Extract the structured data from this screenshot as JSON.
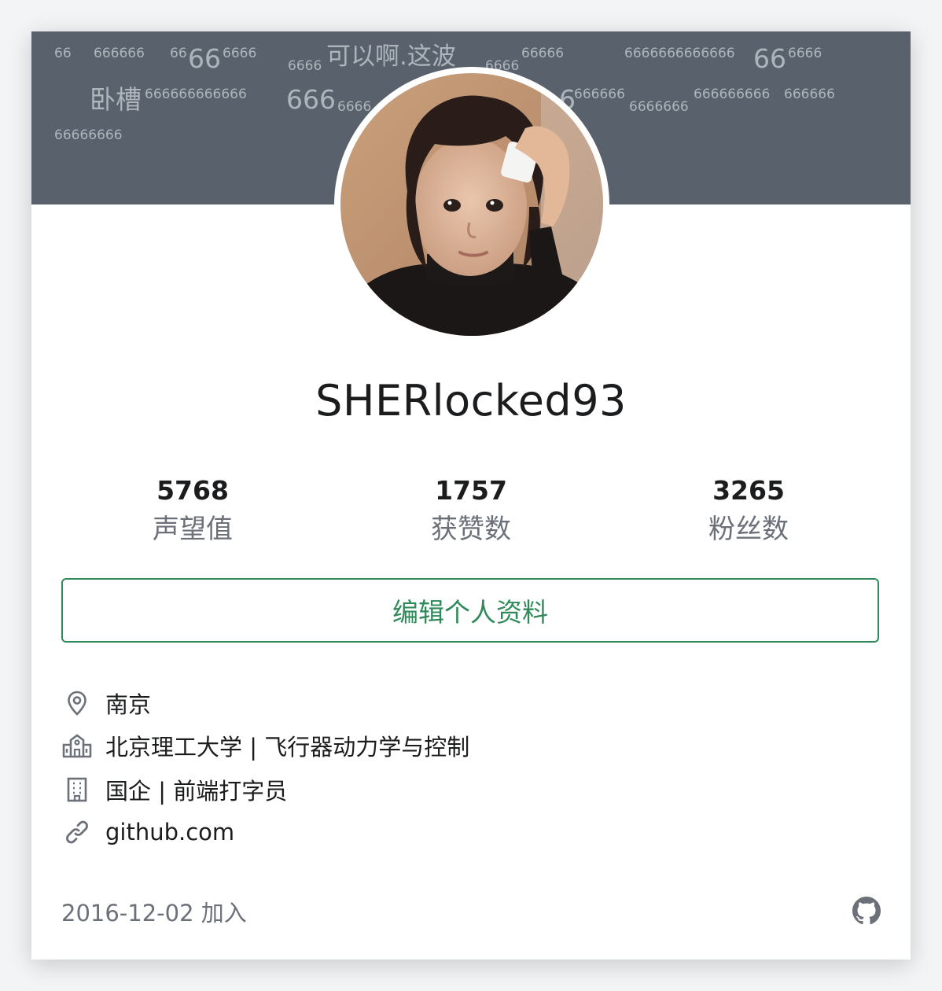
{
  "banner": {
    "danmaku": [
      "66",
      "666666",
      "66",
      "66",
      "6666",
      "6666",
      "可以啊.这波",
      "6666",
      "66666",
      "6666666666666",
      "66",
      "6666",
      "卧槽",
      "666666666666",
      "666",
      "6666",
      "6",
      "666666",
      "6666666",
      "666666666",
      "666666",
      "66666666"
    ]
  },
  "profile": {
    "username": "SHERlocked93",
    "avatar_icon": "user-avatar-photo"
  },
  "stats": [
    {
      "value": "5768",
      "label": "声望值"
    },
    {
      "value": "1757",
      "label": "获赞数"
    },
    {
      "value": "3265",
      "label": "粉丝数"
    }
  ],
  "actions": {
    "edit_label": "编辑个人资料"
  },
  "info": {
    "location": "南京",
    "education": "北京理工大学 | 飞行器动力学与控制",
    "company": "国企 | 前端打字员",
    "website": "github.com"
  },
  "footer": {
    "joined": "2016-12-02 加入",
    "github_icon": "github-icon"
  },
  "colors": {
    "banner": "#59626c",
    "accent": "#2f8a5a",
    "muted_text": "#6b7079",
    "main_text": "#1b1c1e"
  }
}
